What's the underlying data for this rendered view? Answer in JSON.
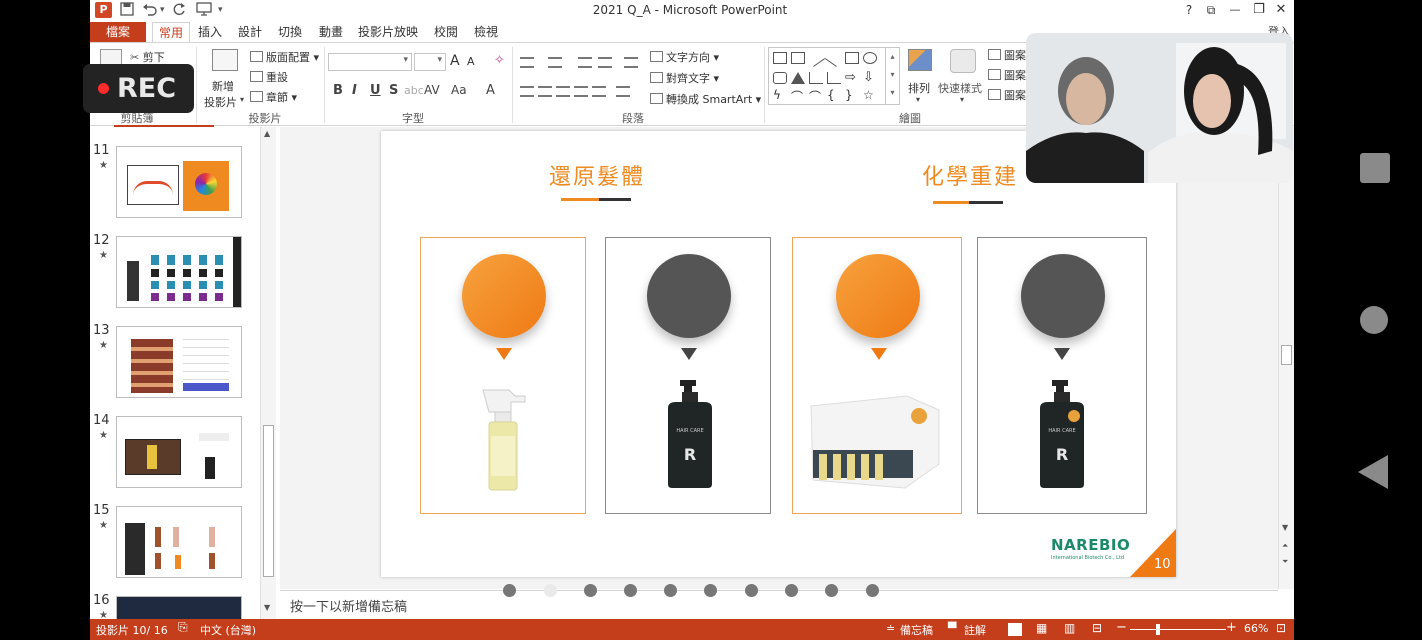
{
  "window": {
    "title": "2021 Q_A - Microsoft PowerPoint",
    "app_logo": "P",
    "help": "?",
    "ribbon_display": "⧉",
    "minimize": "—",
    "restore": "❐",
    "close": "✕",
    "login": "登入"
  },
  "tabs": [
    {
      "label": "檔案"
    },
    {
      "label": "常用"
    },
    {
      "label": "插入"
    },
    {
      "label": "設計"
    },
    {
      "label": "切換"
    },
    {
      "label": "動畫"
    },
    {
      "label": "投影片放映"
    },
    {
      "label": "校閱"
    },
    {
      "label": "檢視"
    }
  ],
  "ribbon": {
    "clipboard": {
      "cut": "剪下",
      "label": "剪貼簿"
    },
    "slides": {
      "new_line1": "新增",
      "new_line2": "投影片",
      "layout": "版面配置",
      "reset": "重設",
      "section": "章節",
      "label": "投影片"
    },
    "font": {
      "grow": "A",
      "shrink": "A",
      "clear": "✧",
      "bold": "B",
      "italic": "I",
      "underline": "U",
      "strike": "S",
      "spacing": "AV",
      "case": "Aa",
      "color": "A",
      "label": "字型"
    },
    "paragraph": {
      "text_direction": "文字方向",
      "align_text": "對齊文字",
      "smartart": "轉換成 SmartArt",
      "label": "段落"
    },
    "drawing": {
      "arrange": "排列",
      "quick_styles": "快速樣式",
      "shape_fill": "圖案",
      "shape_outline": "圖案",
      "shape_effects": "圖案",
      "label": "繪圖"
    }
  },
  "thumbnails": [
    {
      "number": "11",
      "star": "★"
    },
    {
      "number": "12",
      "star": "★"
    },
    {
      "number": "13",
      "star": "★"
    },
    {
      "number": "14",
      "star": "★"
    },
    {
      "number": "15",
      "star": "★"
    },
    {
      "number": "16",
      "star": "★"
    }
  ],
  "slide": {
    "heading_left": "還原髮體",
    "heading_right": "化學重建",
    "brand": "NAREBIO",
    "brand_sub": "International Biotech Co., Ltd",
    "page_number": "10",
    "product_label": "R",
    "product_brand": "HAIR CARE"
  },
  "notes": {
    "placeholder": "按一下以新增備忘稿"
  },
  "status": {
    "slide_counter": "投影片 10/ 16",
    "language": "中文 (台灣)",
    "notes_btn": "備忘稿",
    "comments_btn": "註解",
    "zoom": "66%"
  },
  "overlay": {
    "rec_label": "REC"
  },
  "carousel": {
    "active_index": 1,
    "count": 10
  },
  "colors": {
    "accent": "#c43e1c",
    "slide_orange": "#ef7a14",
    "slide_gray": "#555555"
  }
}
